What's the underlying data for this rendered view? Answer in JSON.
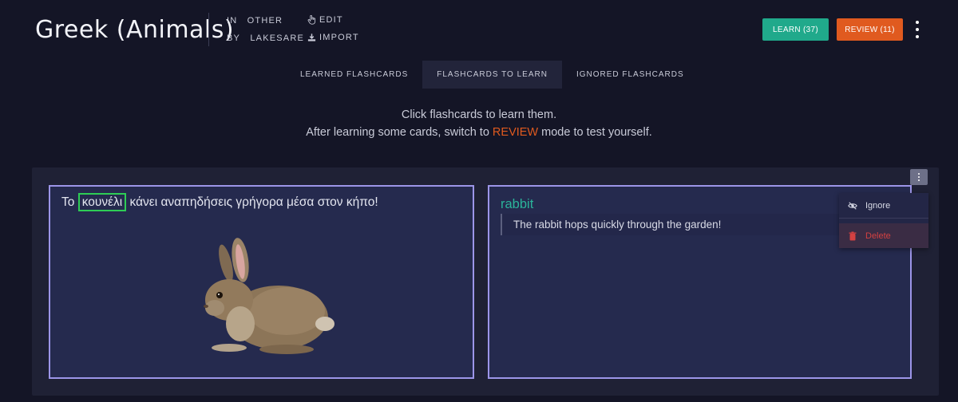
{
  "header": {
    "title": "Greek (Animals)",
    "category_key": "IN",
    "category_value": "OTHER",
    "author_key": "BY",
    "author_value": "LAKESARE",
    "edit_label": "EDIT",
    "import_label": "IMPORT",
    "learn_button": "LEARN (37)",
    "review_button": "REVIEW (11)"
  },
  "tabs": [
    {
      "label": "LEARNED FLASHCARDS"
    },
    {
      "label": "FLASHCARDS TO LEARN"
    },
    {
      "label": "IGNORED FLASHCARDS"
    }
  ],
  "hint": {
    "line1": "Click flashcards to learn them.",
    "line2_before": "After learning some cards, switch to ",
    "line2_accent": "REVIEW",
    "line2_after": " mode to test yourself."
  },
  "card": {
    "sentence_before": "Το ",
    "highlighted_word": "κουνέλι",
    "sentence_after": " κάνει αναπηδήσεις γρήγορα μέσα στον κήπο!",
    "word": "rabbit",
    "translation": "The rabbit hops quickly through the garden!"
  },
  "menu": {
    "ignore_label": "Ignore",
    "delete_label": "Delete"
  },
  "colors": {
    "learn": "#20a98b",
    "review": "#e05a1f",
    "highlight": "#2ecc55",
    "card_border": "#9c95e8",
    "word": "#2bb39a"
  }
}
